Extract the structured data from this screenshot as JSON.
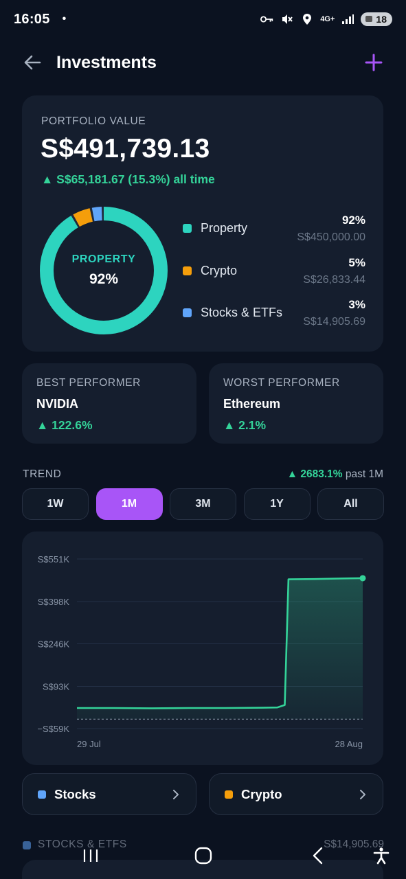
{
  "status_bar": {
    "time": "16:05",
    "notification_dot": "•",
    "network": "4G+",
    "battery": "18",
    "icons": [
      "key-icon",
      "mute-icon",
      "location-icon",
      "network-icon",
      "signal-icon",
      "battery-icon"
    ]
  },
  "header": {
    "title": "Investments",
    "back_icon": "arrow-left-icon",
    "add_icon": "plus-icon",
    "accent_color": "#a855f7"
  },
  "portfolio": {
    "label": "PORTFOLIO VALUE",
    "value": "S$491,739.13",
    "change": "▲ S$65,181.67 (15.3%) all time",
    "donut_center_label": "PROPERTY",
    "donut_center_value": "92%",
    "allocation": [
      {
        "name": "Property",
        "percent_label": "92%",
        "percent": 92,
        "amount": "S$450,000.00",
        "color": "#2dd4bf"
      },
      {
        "name": "Crypto",
        "percent_label": "5%",
        "percent": 5,
        "amount": "S$26,833.44",
        "color": "#f59e0b"
      },
      {
        "name": "Stocks & ETFs",
        "percent_label": "3%",
        "percent": 3,
        "amount": "S$14,905.69",
        "color": "#60a5fa"
      }
    ]
  },
  "best_performer": {
    "label": "BEST PERFORMER",
    "name": "NVIDIA",
    "change": "▲ 122.6%"
  },
  "worst_performer": {
    "label": "WORST PERFORMER",
    "name": "Ethereum",
    "change": "▲ 2.1%"
  },
  "trend": {
    "label": "TREND",
    "change": "▲ 2683.1%",
    "change_suffix": "past 1M",
    "ranges": [
      "1W",
      "1M",
      "3M",
      "1Y",
      "All"
    ],
    "active_range": "1M"
  },
  "chart_data": {
    "type": "area",
    "y_tick_labels": [
      "S$551K",
      "S$398K",
      "S$246K",
      "S$93K",
      "−S$59K"
    ],
    "y_ticks": [
      551,
      398,
      246,
      93,
      -59
    ],
    "ylim": [
      -59,
      551
    ],
    "x_labels": [
      "29 Jul",
      "28 Aug"
    ],
    "baseline_value": -25,
    "series": [
      {
        "values": [
          {
            "x": 0,
            "y": 15
          },
          {
            "x": 5,
            "y": 15
          },
          {
            "x": 10,
            "y": 14
          },
          {
            "x": 15,
            "y": 15
          },
          {
            "x": 20,
            "y": 15
          },
          {
            "x": 25,
            "y": 16
          },
          {
            "x": 27,
            "y": 17
          },
          {
            "x": 28,
            "y": 26
          },
          {
            "x": 28.5,
            "y": 478
          },
          {
            "x": 32,
            "y": 479
          },
          {
            "x": 36,
            "y": 481
          },
          {
            "x": 38.5,
            "y": 482
          }
        ],
        "color": "#34d399"
      }
    ],
    "x_range": [
      0,
      38.5
    ],
    "grid": true
  },
  "categories": [
    {
      "name": "Stocks",
      "color": "#60a5fa",
      "chevron": "chevron-right-icon"
    },
    {
      "name": "Crypto",
      "color": "#f59e0b",
      "chevron": "chevron-right-icon"
    }
  ],
  "section_peek": {
    "label": "STOCKS & ETFS",
    "amount": "S$14,905.69"
  },
  "nav_bar": {
    "icons": [
      "recents-icon",
      "home-icon",
      "back-nav-icon",
      "accessibility-icon"
    ]
  }
}
